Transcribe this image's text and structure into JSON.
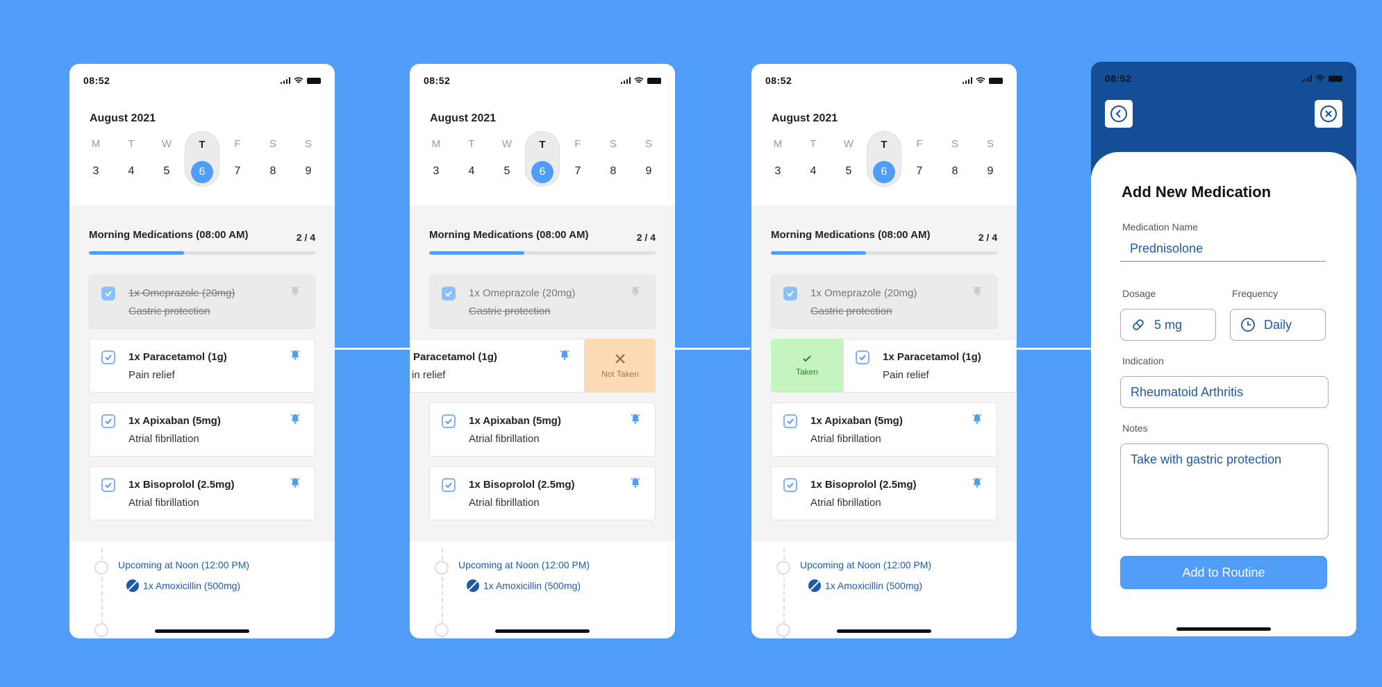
{
  "colors": {
    "background": "#4f9cf9",
    "accent": "#4f9cf9",
    "header": "#134e97",
    "text_link": "#1e5aa8",
    "not_taken": "#fddcb5",
    "taken": "#c6f6bf"
  },
  "status": {
    "time": "08:52"
  },
  "calendar": {
    "month": "August 2021",
    "days": [
      {
        "letter": "M",
        "num": "3"
      },
      {
        "letter": "T",
        "num": "4"
      },
      {
        "letter": "W",
        "num": "5"
      },
      {
        "letter": "T",
        "num": "6",
        "selected": true
      },
      {
        "letter": "F",
        "num": "7"
      },
      {
        "letter": "S",
        "num": "8"
      },
      {
        "letter": "S",
        "num": "9"
      }
    ]
  },
  "morning": {
    "title": "Morning Medications (08:00 AM)",
    "count": "2 / 4",
    "progress": 0.42,
    "items": [
      {
        "name": "1x Omeprazole (20mg)",
        "sub": "Gastric protection",
        "done": true
      },
      {
        "name": "1x Paracetamol (1g)",
        "sub": "Pain relief"
      },
      {
        "name": "1x Apixaban (5mg)",
        "sub": "Atrial fibrillation"
      },
      {
        "name": "1x Bisoprolol (2.5mg)",
        "sub": "Atrial fibrillation"
      }
    ]
  },
  "swipe": {
    "not_taken": "Not Taken",
    "taken": "Taken",
    "partial_name": "Paracetamol (1g)",
    "partial_sub": "in relief"
  },
  "upcoming": {
    "title": "Upcoming at Noon (12:00 PM)",
    "item": "1x Amoxicillin (500mg)"
  },
  "form": {
    "title": "Add New Medication",
    "name_label": "Medication Name",
    "name_value": "Prednisolone",
    "dosage_label": "Dosage",
    "dosage_value": "5 mg",
    "frequency_label": "Frequency",
    "frequency_value": "Daily",
    "indication_label": "Indication",
    "indication_value": "Rheumatoid Arthritis",
    "notes_label": "Notes",
    "notes_value": "Take with gastric protection",
    "submit": "Add to Routine"
  }
}
